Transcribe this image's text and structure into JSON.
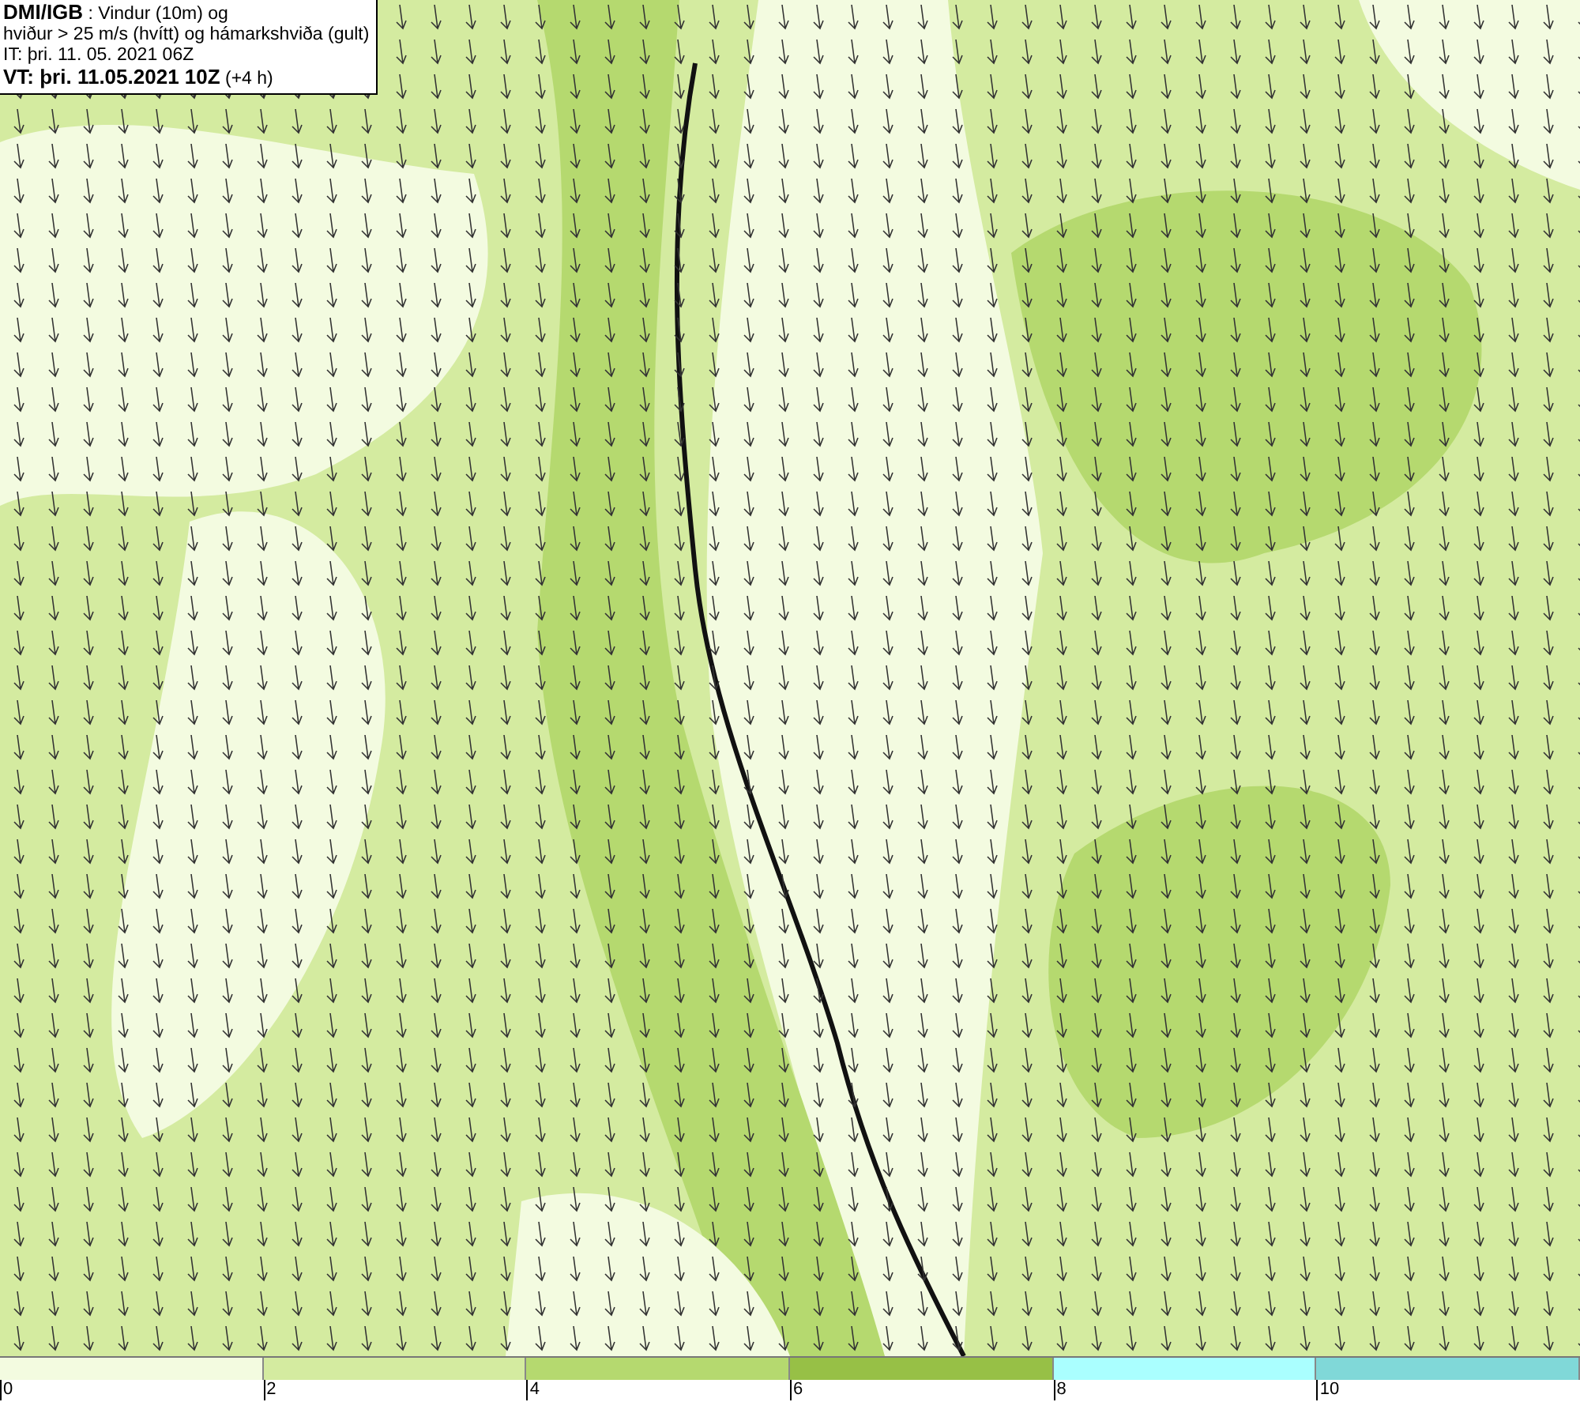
{
  "header": {
    "lines": [
      "**DMI/IGB** : Vindur (10m) og",
      "hviður > 25 m/s (hvítt) og hámarkshviða (gult)",
      "IT: þri. 11. 05. 2021 06Z",
      "**VT: þri. 11.05.2021 10Z** (+4 h)"
    ]
  },
  "legend": {
    "bins": [
      {
        "color": "#f3fbe0"
      },
      {
        "color": "#d4eba0"
      },
      {
        "color": "#b5d96f"
      },
      {
        "color": "#97c046"
      },
      {
        "color": "#aaffff"
      },
      {
        "color": "#80d8d8"
      }
    ],
    "ticks": [
      "0",
      "2",
      "4",
      "6",
      "8",
      "10"
    ]
  }
}
